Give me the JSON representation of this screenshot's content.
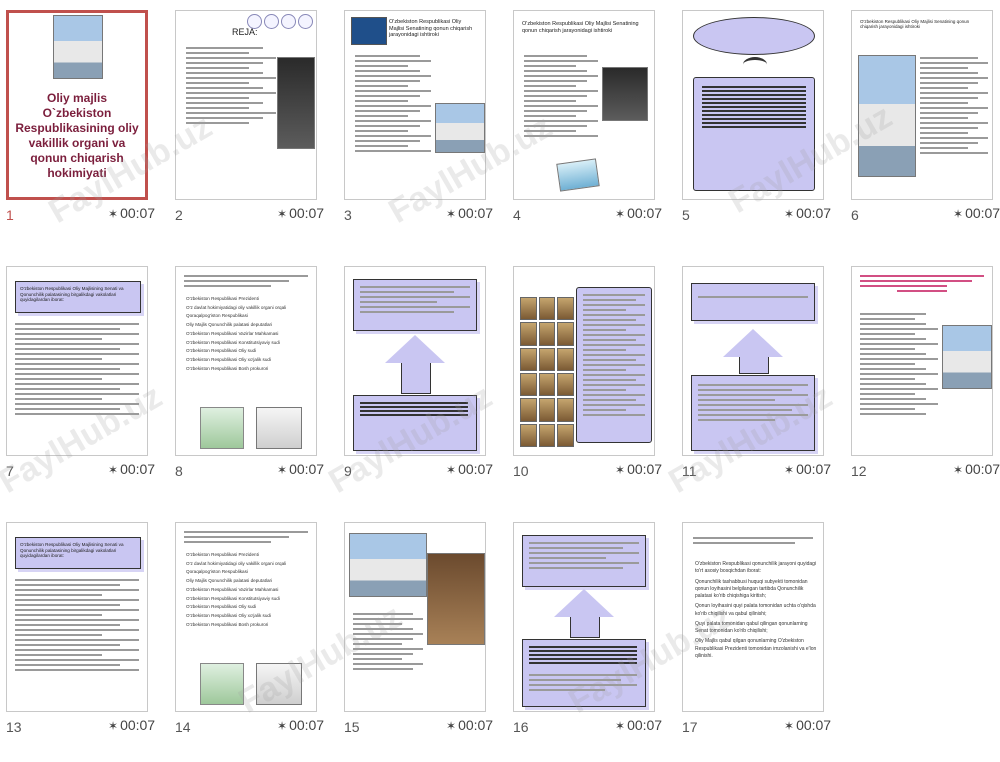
{
  "slides": [
    {
      "number": "1",
      "time": "00:07",
      "title": "Oliy majlis O`zbekiston Respublikasining oliy vakillik organi va qonun chiqarish hokimiyati"
    },
    {
      "number": "2",
      "time": "00:07",
      "title": "REJA:"
    },
    {
      "number": "3",
      "time": "00:07",
      "title": "O'zbekiston Respublikasi Oliy Majlisi Senatining qonun chiqarish jarayonidagi ishtiroki"
    },
    {
      "number": "4",
      "time": "00:07",
      "title": "O'zbekiston Respublikasi Oliy Majlisi Senatining qonun chiqarish jarayonidagi ishtiroki"
    },
    {
      "number": "5",
      "time": "00:07"
    },
    {
      "number": "6",
      "time": "00:07",
      "title": "O'zbekiston Respublikasi Oliy Majlisi Senatining qonun chiqarish jarayonidagi ishtiroki"
    },
    {
      "number": "7",
      "time": "00:07",
      "title": "O'zbekiston Respublikasi Oliy Majlisining Senati va Qonunchilik palatasining birgalikdagi vakolatlari quyidagilardan iborat:"
    },
    {
      "number": "8",
      "time": "00:07",
      "items": [
        "O'zbekiston Respublikasi Prezidenti",
        "O'z davlat hokimiyatidagi oliy vakillik organi orqali Qoraqalpog'iston Respublikasi",
        "Oliy Majlis Qonunchilik palatasi deputatlari",
        "O'zbekiston Respublikasi Vazirlar Mahkamasi",
        "O'zbekiston Respublikasi Konstitutsiyaviy sudi",
        "O'zbekiston Respublikasi Oliy sudi",
        "O'zbekiston Respublikasi Oliy xo'jalik sudi",
        "O'zbekiston Respublikasi Bosh prokurori"
      ]
    },
    {
      "number": "9",
      "time": "00:07"
    },
    {
      "number": "10",
      "time": "00:07"
    },
    {
      "number": "11",
      "time": "00:07"
    },
    {
      "number": "12",
      "time": "00:07"
    },
    {
      "number": "13",
      "time": "00:07",
      "title": "O'zbekiston Respublikasi Oliy Majlisining Senati va Qonunchilik palatasining birgalikdagi vakolatlari quyidagilardan iborat:"
    },
    {
      "number": "14",
      "time": "00:07",
      "items": [
        "O'zbekiston Respublikasi Prezidenti",
        "O'z davlat hokimiyatidagi oliy vakillik organi orqali Qoraqalpog'iston Respublikasi",
        "Oliy Majlis Qonunchilik palatasi deputatlari",
        "O'zbekiston Respublikasi Vazirlar Mahkamasi",
        "O'zbekiston Respublikasi Konstitutsiyaviy sudi",
        "O'zbekiston Respublikasi Oliy sudi",
        "O'zbekiston Respublikasi Oliy xo'jalik sudi",
        "O'zbekiston Respublikasi Bosh prokurori"
      ]
    },
    {
      "number": "15",
      "time": "00:07"
    },
    {
      "number": "16",
      "time": "00:07"
    },
    {
      "number": "17",
      "time": "00:07",
      "items": [
        "O'zbekiston Respublikasi qonunchilik jarayoni quyidagi to'rt asosiy bosqichdan iborat:",
        "Qonunchilik tashabbusi huquqi subyekti tomonidan qonun loyihasini belgilangan tartibda Qonunchilik palatasi ko'rib chiqishiga kiritish;",
        "Qonun loyihasini quyi palata tomonidan uchta o'qishda ko'rib chiqilishi va qabul qilinishi;",
        "Quyi palata tomonidan qabul qilingan qonunlarning Senat tomonidan ko'rib chiqilishi;",
        "Oliy Majlis qabul qilgan qonunlarning O'zbekiston Respublikasi Prezidenti tomonidan imzolanishi va e'lon qilinishi."
      ]
    }
  ],
  "time_icon": "star-icon",
  "watermark": "FaylHub.uz",
  "accent_selected": "#c0504d",
  "slide_title_color": "#7b1e3c",
  "banner_color": "#c9c6f2"
}
